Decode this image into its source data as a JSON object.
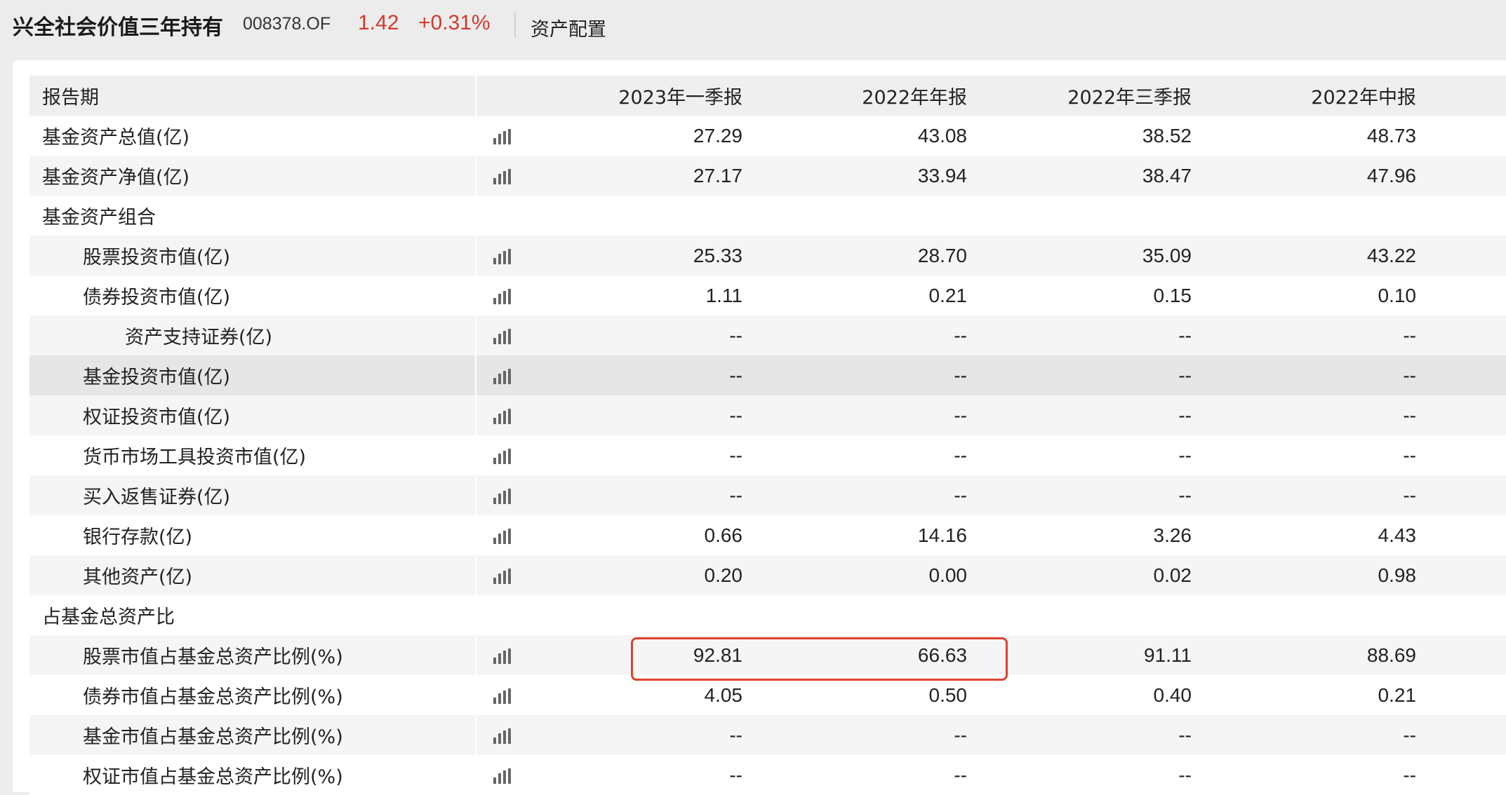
{
  "header": {
    "fund_name": "兴全社会价值三年持有",
    "fund_code": "008378.OF",
    "nav": "1.42",
    "change": "+0.31%",
    "tab": "资产配置"
  },
  "table": {
    "header_label": "报告期",
    "columns": [
      "2023年一季报",
      "2022年年报",
      "2022年三季报",
      "2022年中报"
    ],
    "rows": [
      {
        "label": "基金资产总值(亿)",
        "values": [
          "27.29",
          "43.08",
          "38.52",
          "48.73"
        ]
      },
      {
        "label": "基金资产净值(亿)",
        "values": [
          "27.17",
          "33.94",
          "38.47",
          "47.96"
        ]
      },
      {
        "label": "基金资产组合"
      },
      {
        "label": "股票投资市值(亿)",
        "values": [
          "25.33",
          "28.70",
          "35.09",
          "43.22"
        ]
      },
      {
        "label": "债券投资市值(亿)",
        "values": [
          "1.11",
          "0.21",
          "0.15",
          "0.10"
        ]
      },
      {
        "label": "资产支持证券(亿)",
        "values": [
          "--",
          "--",
          "--",
          "--"
        ]
      },
      {
        "label": "基金投资市值(亿)",
        "values": [
          "--",
          "--",
          "--",
          "--"
        ]
      },
      {
        "label": "权证投资市值(亿)",
        "values": [
          "--",
          "--",
          "--",
          "--"
        ]
      },
      {
        "label": "货币市场工具投资市值(亿)",
        "values": [
          "--",
          "--",
          "--",
          "--"
        ]
      },
      {
        "label": "买入返售证券(亿)",
        "values": [
          "--",
          "--",
          "--",
          "--"
        ]
      },
      {
        "label": "银行存款(亿)",
        "values": [
          "0.66",
          "14.16",
          "3.26",
          "4.43"
        ]
      },
      {
        "label": "其他资产(亿)",
        "values": [
          "0.20",
          "0.00",
          "0.02",
          "0.98"
        ]
      },
      {
        "label": "占基金总资产比"
      },
      {
        "label": "股票市值占基金总资产比例(%)",
        "values": [
          "92.81",
          "66.63",
          "91.11",
          "88.69"
        ]
      },
      {
        "label": "债券市值占基金总资产比例(%)",
        "values": [
          "4.05",
          "0.50",
          "0.40",
          "0.21"
        ]
      },
      {
        "label": "基金市值占基金总资产比例(%)",
        "values": [
          "--",
          "--",
          "--",
          "--"
        ]
      },
      {
        "label": "权证市值占基金总资产比例(%)",
        "values": [
          "--",
          "--",
          "--",
          "--"
        ]
      }
    ]
  },
  "colors": {
    "price_up": "#d23a2d",
    "highlight_box": "#e0422f",
    "hover_row": "#e6e6e6"
  },
  "icons": {
    "row_chart": "bar-chart-icon"
  }
}
